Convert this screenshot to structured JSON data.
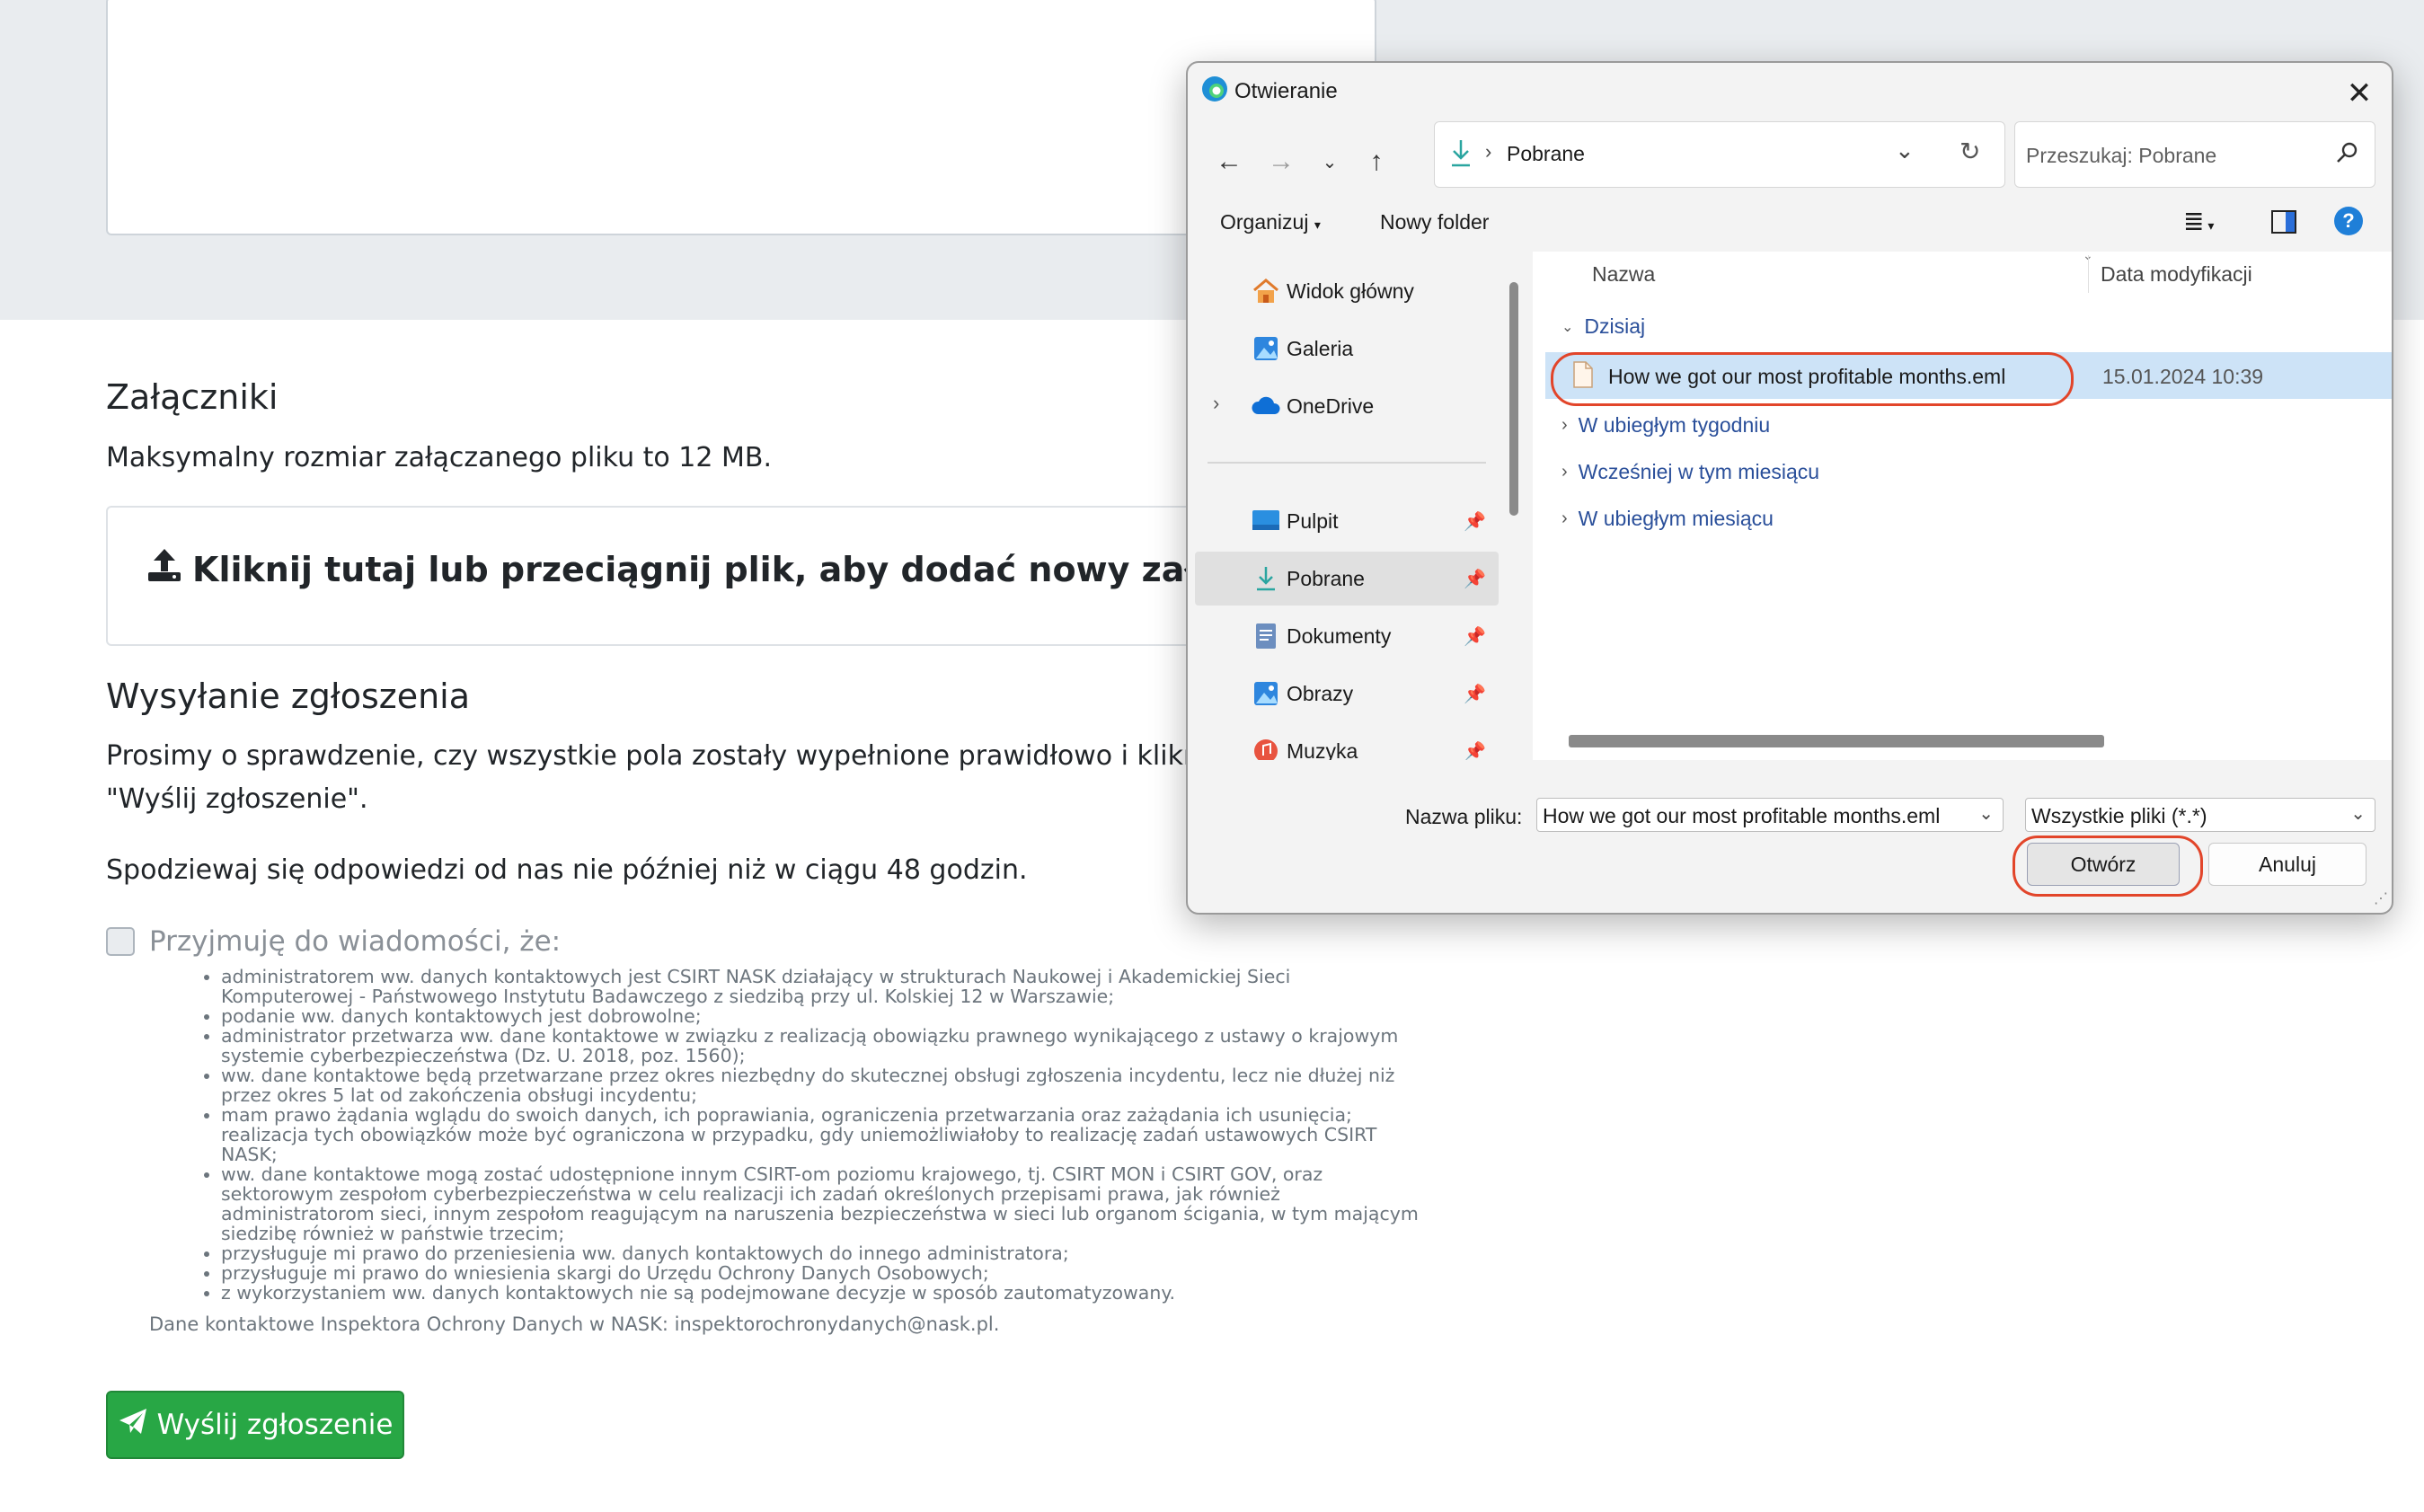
{
  "form": {
    "attachments_heading": "Załączniki",
    "attachments_note": "Maksymalny rozmiar załączanego pliku to 12 MB.",
    "drop_zone": "Kliknij tutaj lub przeciągnij plik, aby dodać nowy załącznik.",
    "submit_heading": "Wysyłanie zgłoszenia",
    "submit_text_1": "Prosimy o sprawdzenie, czy wszystkie pola zostały wypełnione prawidłowo i kliknięcie",
    "submit_text_2": "\"Wyślij zgłoszenie\".",
    "response_text": "Spodziewaj się odpowiedzi od nas nie później niż w ciągu 48 godzin.",
    "ack_label": "Przyjmuję do wiadomości, że:",
    "ack_items": [
      "administratorem ww. danych kontaktowych jest CSIRT NASK działający w strukturach Naukowej i Akademickiej Sieci Komputerowej - Państwowego Instytutu Badawczego z siedzibą przy ul. Kolskiej 12 w Warszawie;",
      "podanie ww. danych kontaktowych jest dobrowolne;",
      "administrator przetwarza ww. dane kontaktowe w związku z realizacją obowiązku prawnego wynikającego z ustawy o krajowym systemie cyberbezpieczeństwa (Dz. U. 2018, poz. 1560);",
      "ww. dane kontaktowe będą przetwarzane przez okres niezbędny do skutecznej obsługi zgłoszenia incydentu, lecz nie dłużej niż przez okres 5 lat od zakończenia obsługi incydentu;",
      "mam prawo żądania wglądu do swoich danych, ich poprawiania, ograniczenia przetwarzania oraz zażądania ich usunięcia; realizacja tych obowiązków może być ograniczona w przypadku, gdy uniemożliwiałoby to realizację zadań ustawowych CSIRT NASK;",
      "ww. dane kontaktowe mogą zostać udostępnione innym CSIRT-om poziomu krajowego, tj. CSIRT MON i CSIRT GOV, oraz sektorowym zespołom cyberbezpieczeństwa w celu realizacji ich zadań określonych przepisami prawa, jak również administratorom sieci, innym zespołom reagującym na naruszenia bezpieczeństwa w sieci lub organom ścigania, w tym mającym siedzibę również w państwie trzecim;",
      "przysługuje mi prawo do przeniesienia ww. danych kontaktowych do innego administratora;",
      "przysługuje mi prawo do wniesienia skargi do Urzędu Ochrony Danych Osobowych;",
      "z wykorzystaniem ww. danych kontaktowych nie są podejmowane decyzje w sposób zautomatyzowany."
    ],
    "iod_contact": "Dane kontaktowe Inspektora Ochrony Danych w NASK: inspektorochronydanych@nask.pl.",
    "send_button": "Wyślij zgłoszenie"
  },
  "dialog": {
    "title": "Otwieranie",
    "address": "Pobrane",
    "search_placeholder": "Przeszukaj: Pobrane",
    "organize": "Organizuj",
    "new_folder": "Nowy folder",
    "nav_items": [
      {
        "label": "Widok główny",
        "icon": "home-icon",
        "pinned": false
      },
      {
        "label": "Galeria",
        "icon": "gallery-icon",
        "pinned": false
      },
      {
        "label": "OneDrive",
        "icon": "onedrive-icon",
        "pinned": false
      },
      {
        "label": "Pulpit",
        "icon": "desktop-icon",
        "pinned": true
      },
      {
        "label": "Pobrane",
        "icon": "download-icon",
        "pinned": true
      },
      {
        "label": "Dokumenty",
        "icon": "documents-icon",
        "pinned": true
      },
      {
        "label": "Obrazy",
        "icon": "pictures-icon",
        "pinned": true
      },
      {
        "label": "Muzyka",
        "icon": "music-icon",
        "pinned": true
      }
    ],
    "columns": {
      "name": "Nazwa",
      "date": "Data modyfikacji"
    },
    "groups": {
      "today": "Dzisiaj",
      "last_week": "W ubiegłym tygodniu",
      "earlier_month": "Wcześniej w tym miesiącu",
      "last_month": "W ubiegłym miesiącu"
    },
    "file": {
      "name": "How we got our most profitable months.eml",
      "date": "15.01.2024 10:39"
    },
    "filename_label": "Nazwa pliku:",
    "filename_value": "How we got our most profitable months.eml",
    "filetype_value": "Wszystkie pliki (*.*)",
    "open_button": "Otwórz",
    "cancel_button": "Anuluj",
    "highlight_color": "#e2452a",
    "selection_color": "#cde3f7"
  }
}
